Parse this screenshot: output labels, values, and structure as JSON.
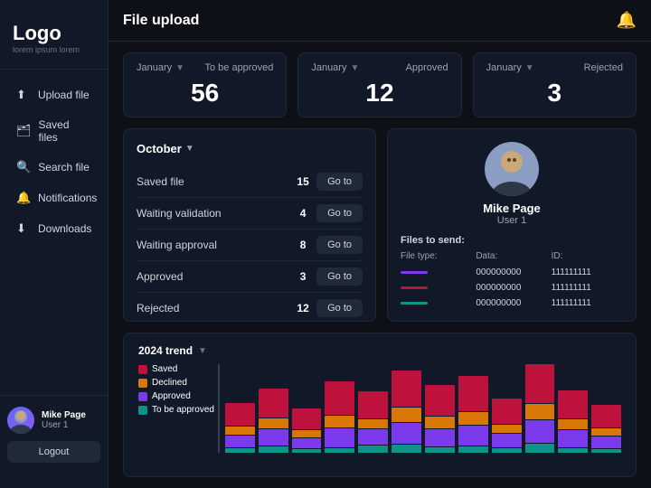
{
  "sidebar": {
    "logo": "Logo",
    "logoSub": "lorem ipsum lorem",
    "nav": [
      {
        "id": "upload-file",
        "label": "Upload file",
        "icon": "⬆"
      },
      {
        "id": "saved-files",
        "label": "Saved files",
        "icon": "🗂"
      },
      {
        "id": "search-file",
        "label": "Search file",
        "icon": "🔍"
      },
      {
        "id": "notifications",
        "label": "Notifications",
        "icon": "🔔"
      },
      {
        "id": "downloads",
        "label": "Downloads",
        "icon": "⬇"
      }
    ],
    "user": {
      "name": "Mike Page",
      "role": "User 1"
    },
    "logoutLabel": "Logout"
  },
  "header": {
    "title": "File upload"
  },
  "stats": [
    {
      "month": "January",
      "label": "To be approved",
      "value": "56"
    },
    {
      "month": "January",
      "label": "Approved",
      "value": "12"
    },
    {
      "month": "January",
      "label": "Rejected",
      "value": "3"
    }
  ],
  "fileStatus": {
    "month": "October",
    "rows": [
      {
        "label": "Saved file",
        "count": "15"
      },
      {
        "label": "Waiting validation",
        "count": "4"
      },
      {
        "label": "Waiting approval",
        "count": "8"
      },
      {
        "label": "Approved",
        "count": "3"
      },
      {
        "label": "Rejected",
        "count": "12"
      }
    ],
    "gotoLabel": "Go to"
  },
  "userCard": {
    "name": "Mike Page",
    "role": "User 1",
    "filesToSendLabel": "Files to send:",
    "tableHeaders": {
      "fileType": "File type:",
      "data": "Data:",
      "id": "ID:"
    },
    "files": [
      {
        "data": "000000000",
        "id": "111111111",
        "color": "#7c3aed"
      },
      {
        "data": "000000000",
        "id": "111111111",
        "color": "#be123c"
      },
      {
        "data": "000000000",
        "id": "111111111",
        "color": "#0d9488"
      }
    ]
  },
  "chart": {
    "title": "2024 trend",
    "legend": [
      {
        "label": "Saved",
        "color": "#be123c"
      },
      {
        "label": "Declined",
        "color": "#d97706"
      },
      {
        "label": "Approved",
        "color": "#7c3aed"
      },
      {
        "label": "To be approved",
        "color": "#0d9488"
      }
    ],
    "bars": [
      {
        "saved": 55,
        "declined": 20,
        "approved": 30,
        "pending": 10
      },
      {
        "saved": 70,
        "declined": 25,
        "approved": 40,
        "pending": 15
      },
      {
        "saved": 50,
        "declined": 18,
        "approved": 25,
        "pending": 8
      },
      {
        "saved": 80,
        "declined": 30,
        "approved": 45,
        "pending": 12
      },
      {
        "saved": 65,
        "declined": 22,
        "approved": 38,
        "pending": 18
      },
      {
        "saved": 90,
        "declined": 35,
        "approved": 50,
        "pending": 20
      },
      {
        "saved": 75,
        "declined": 28,
        "approved": 42,
        "pending": 14
      },
      {
        "saved": 85,
        "declined": 32,
        "approved": 48,
        "pending": 16
      },
      {
        "saved": 60,
        "declined": 20,
        "approved": 35,
        "pending": 10
      },
      {
        "saved": 95,
        "declined": 38,
        "approved": 55,
        "pending": 22
      },
      {
        "saved": 70,
        "declined": 25,
        "approved": 40,
        "pending": 12
      },
      {
        "saved": 55,
        "declined": 18,
        "approved": 30,
        "pending": 8
      }
    ]
  }
}
